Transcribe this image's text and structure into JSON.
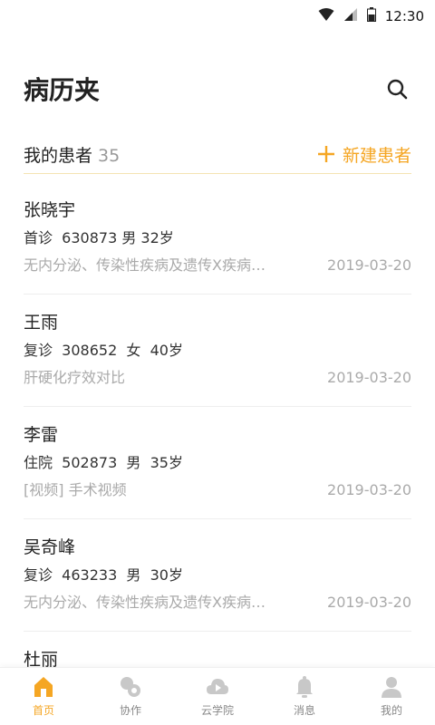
{
  "status_bar": {
    "time": "12:30",
    "icons": [
      "wifi-icon",
      "signal-icon",
      "battery-icon"
    ]
  },
  "header": {
    "title": "病历夹",
    "search_icon": "search-icon"
  },
  "section": {
    "title": "我的患者",
    "count": "35",
    "new_label": "新建患者"
  },
  "patients": [
    {
      "name": "张晓宇",
      "info": "首诊  630873 男 32岁",
      "note": "无内分泌、传染性疾病及遗传X疾病…",
      "date": "2019-03-20"
    },
    {
      "name": "王雨",
      "info": "复诊  308652  女  40岁",
      "note": "肝硬化疗效对比",
      "date": "2019-03-20"
    },
    {
      "name": "李雷",
      "info": "住院  502873  男  35岁",
      "note": "[视频] 手术视频",
      "date": "2019-03-20"
    },
    {
      "name": "吴奇峰",
      "info": "复诊  463233  男  30岁",
      "note": "无内分泌、传染性疾病及遗传X疾病…",
      "date": "2019-03-20"
    },
    {
      "name": "杜丽",
      "info": "",
      "note": "",
      "date": ""
    }
  ],
  "tabs": [
    {
      "label": "首页",
      "icon": "home-icon",
      "active": true
    },
    {
      "label": "协作",
      "icon": "collaboration-icon",
      "active": false
    },
    {
      "label": "云学院",
      "icon": "cloud-play-icon",
      "active": false
    },
    {
      "label": "消息",
      "icon": "bell-icon",
      "active": false
    },
    {
      "label": "我的",
      "icon": "user-icon",
      "active": false
    }
  ],
  "colors": {
    "accent": "#f5a623",
    "inactive_icon": "#c8c8c8",
    "divider_accent": "#f4e3b3"
  }
}
